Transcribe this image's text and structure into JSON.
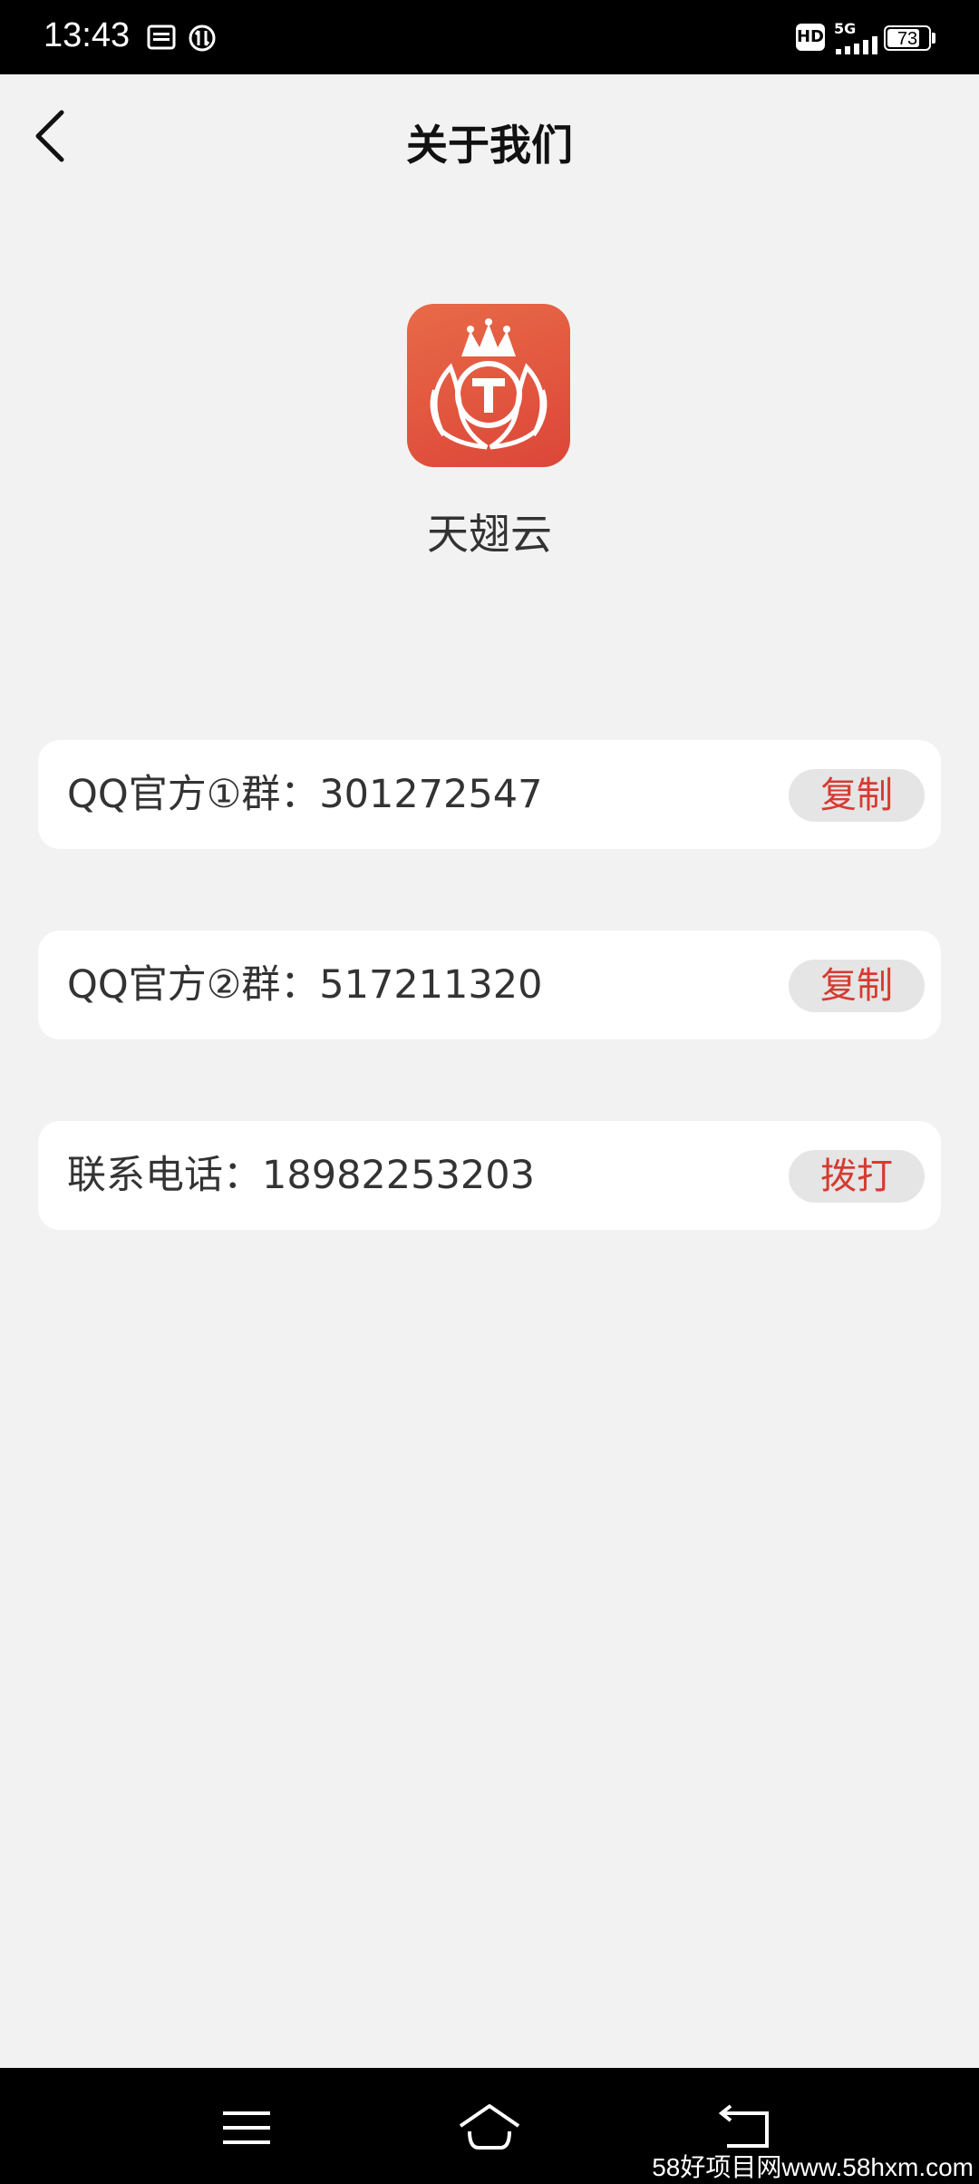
{
  "status_bar": {
    "time": "13:43",
    "battery": "73",
    "network": "5G",
    "hd": "HD",
    "notification_icons": [
      "toutiao-icon",
      "data-saver-icon"
    ]
  },
  "header": {
    "title": "关于我们",
    "back_icon": "chevron-left-icon"
  },
  "app": {
    "name": "天翅云",
    "logo_icon": "crown-t-logo",
    "logo_colors": [
      "#e86a48",
      "#dc4638"
    ]
  },
  "contacts": [
    {
      "label": "QQ官方①群：301272547",
      "action": "复制"
    },
    {
      "label": "QQ官方②群：517211320",
      "action": "复制"
    },
    {
      "label": "联系电话：18982253203",
      "action": "拨打"
    }
  ],
  "nav_bar": {
    "buttons": [
      "menu-icon",
      "home-icon",
      "back-icon"
    ]
  },
  "watermark": "58好项目网www.58hxm.com",
  "colors": {
    "accent": "#d63a30",
    "background": "#f2f2f2",
    "card": "#ffffff",
    "button_bg": "#e5e5e5"
  }
}
